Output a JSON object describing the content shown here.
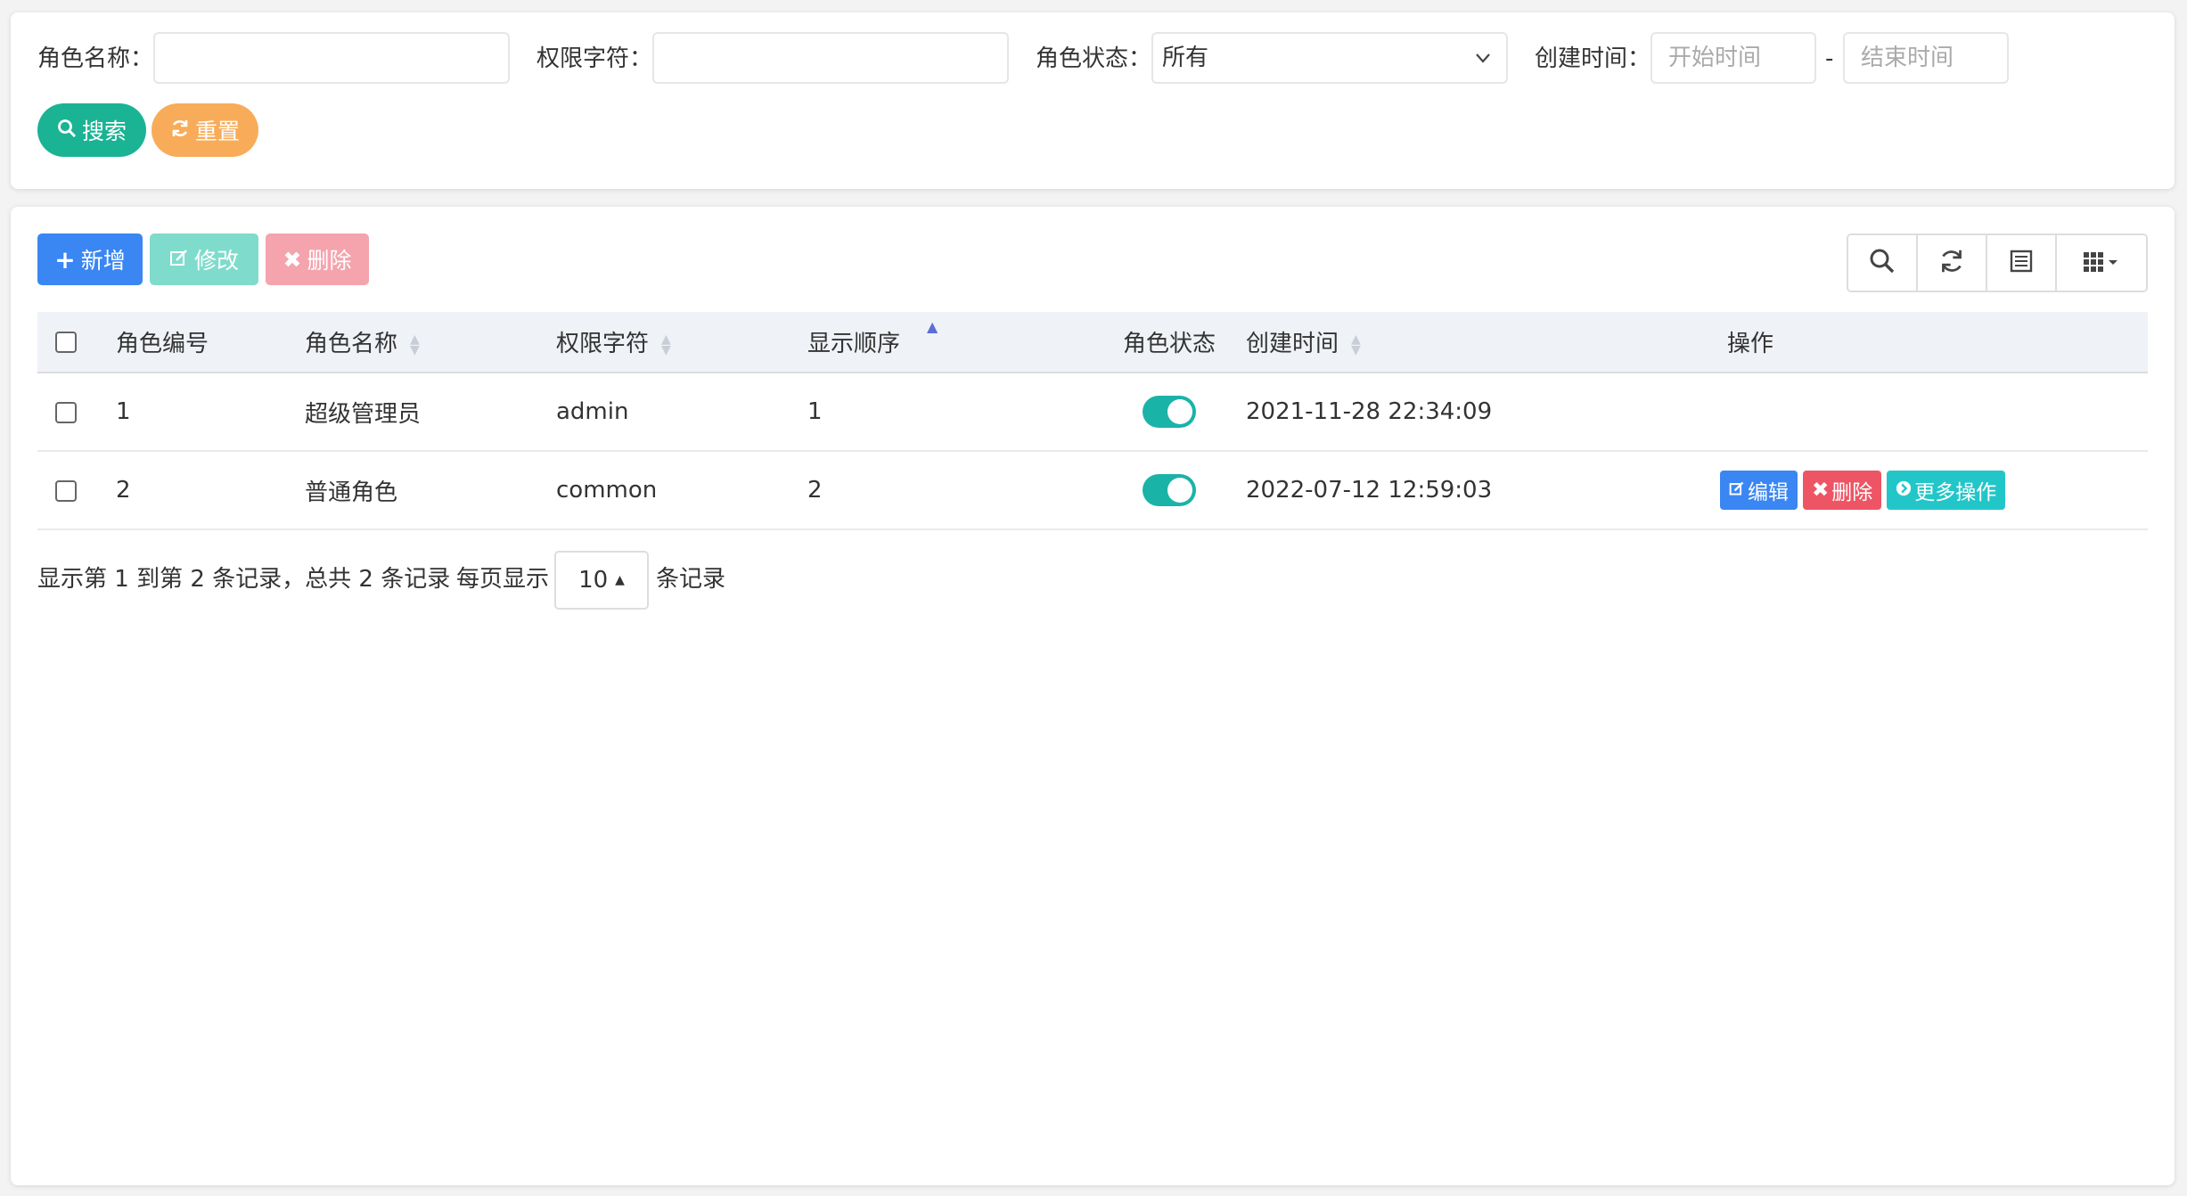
{
  "search": {
    "role_name_label": "角色名称：",
    "role_name_value": "",
    "permission_label": "权限字符：",
    "permission_value": "",
    "status_label": "角色状态：",
    "status_selected": "所有",
    "created_label": "创建时间：",
    "start_placeholder": "开始时间",
    "end_placeholder": "结束时间",
    "range_sep": "-",
    "search_button": "搜索",
    "reset_button": "重置"
  },
  "toolbar": {
    "add_label": "新增",
    "edit_label": "修改",
    "delete_label": "删除"
  },
  "table": {
    "columns": [
      "角色编号",
      "角色名称",
      "权限字符",
      "显示顺序",
      "角色状态",
      "创建时间",
      "操作"
    ],
    "rows": [
      {
        "id": "1",
        "name": "超级管理员",
        "key": "admin",
        "order": "1",
        "enabled": true,
        "created": "2021-11-28 22:34:09",
        "actions": false
      },
      {
        "id": "2",
        "name": "普通角色",
        "key": "common",
        "order": "2",
        "enabled": true,
        "created": "2022-07-12 12:59:03",
        "actions": true
      }
    ],
    "row_actions": {
      "edit": "编辑",
      "delete": "删除",
      "more": "更多操作"
    }
  },
  "pagination": {
    "summary": "显示第 1 到第 2 条记录，总共 2 条记录",
    "per_page_prefix": "每页显示",
    "page_size": "10",
    "per_page_suffix": "条记录"
  },
  "colors": {
    "primary": "#3a86f3",
    "success": "#1ab394",
    "warning": "#f8ac59",
    "danger": "#ed5565",
    "info": "#23c6c8"
  }
}
